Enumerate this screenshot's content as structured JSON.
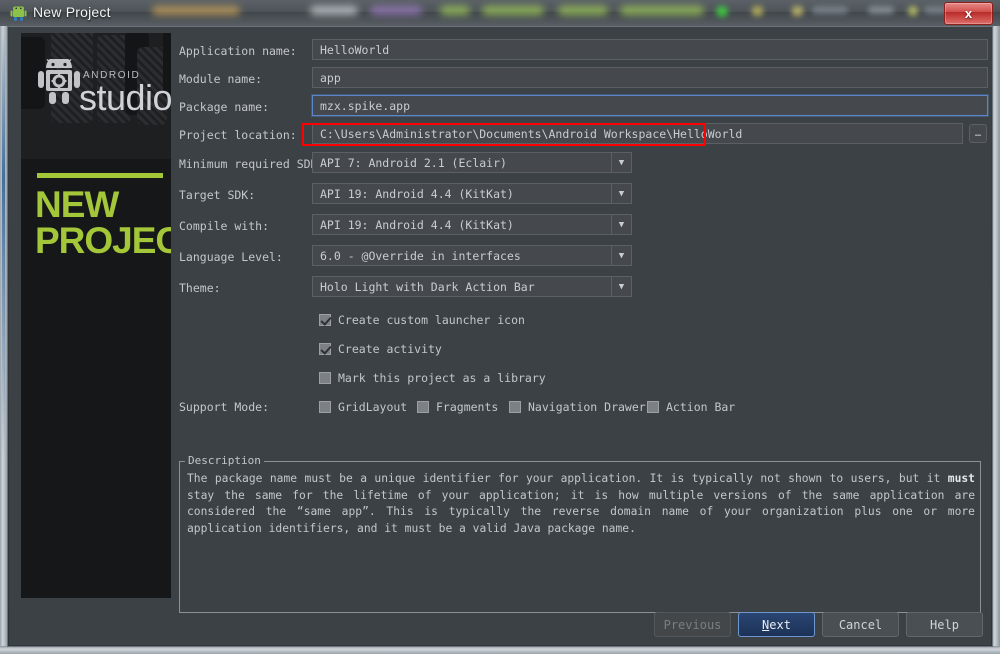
{
  "window": {
    "title": "New Project",
    "app_icon": "android-robot-icon",
    "close_label": "x"
  },
  "branding": {
    "android_word": "ANDROID",
    "studio_word": "studio",
    "headline_line1": "NEW",
    "headline_line2": "PROJECT",
    "accent_green": "#a4c639"
  },
  "form": {
    "application_name": {
      "label": "Application name:",
      "value": "HelloWorld"
    },
    "module_name": {
      "label": "Module name:",
      "value": "app"
    },
    "package_name": {
      "label": "Package name:",
      "value": "mzx.spike.app",
      "focused": true
    },
    "project_location": {
      "label": "Project location:",
      "value": "C:\\Users\\Administrator\\Documents\\Android Workspace\\HelloWorld",
      "browse_label": "…",
      "highlight_color": "#ff0000"
    },
    "minimum_sdk": {
      "label": "Minimum required SDK:",
      "value": "API 7: Android 2.1 (Eclair)"
    },
    "target_sdk": {
      "label": "Target SDK:",
      "value": "API 19: Android 4.4 (KitKat)"
    },
    "compile_with": {
      "label": "Compile with:",
      "value": "API 19: Android 4.4 (KitKat)"
    },
    "language_level": {
      "label": "Language Level:",
      "value": "6.0 - @Override in interfaces"
    },
    "theme": {
      "label": "Theme:",
      "value": "Holo Light with Dark Action Bar"
    },
    "checkboxes": [
      {
        "label": "Create custom launcher icon",
        "checked": true
      },
      {
        "label": "Create activity",
        "checked": true
      },
      {
        "label": "Mark this project as a library",
        "checked": false
      }
    ],
    "support_mode": {
      "label": "Support Mode:",
      "options": [
        {
          "label": "GridLayout",
          "checked": false
        },
        {
          "label": "Fragments",
          "checked": false
        },
        {
          "label": "Navigation Drawer",
          "checked": false
        },
        {
          "label": "Action Bar",
          "checked": false
        }
      ]
    }
  },
  "description": {
    "legend": "Description",
    "text_part1": "The package name must be a unique identifier for your application. It is typically not shown to users, but it ",
    "text_bold": "must",
    "text_part2": " stay the same for the lifetime of your application; it is how multiple versions of the same application are considered the “same app”. This is typically the reverse domain name of your organization plus one or more application identifiers, and it must be a valid Java package name."
  },
  "buttons": {
    "previous": {
      "label": "Previous",
      "disabled": true
    },
    "next": {
      "mnemonic": "N",
      "rest": "ext",
      "primary": true
    },
    "cancel": {
      "label": "Cancel"
    },
    "help": {
      "label": "Help"
    }
  }
}
